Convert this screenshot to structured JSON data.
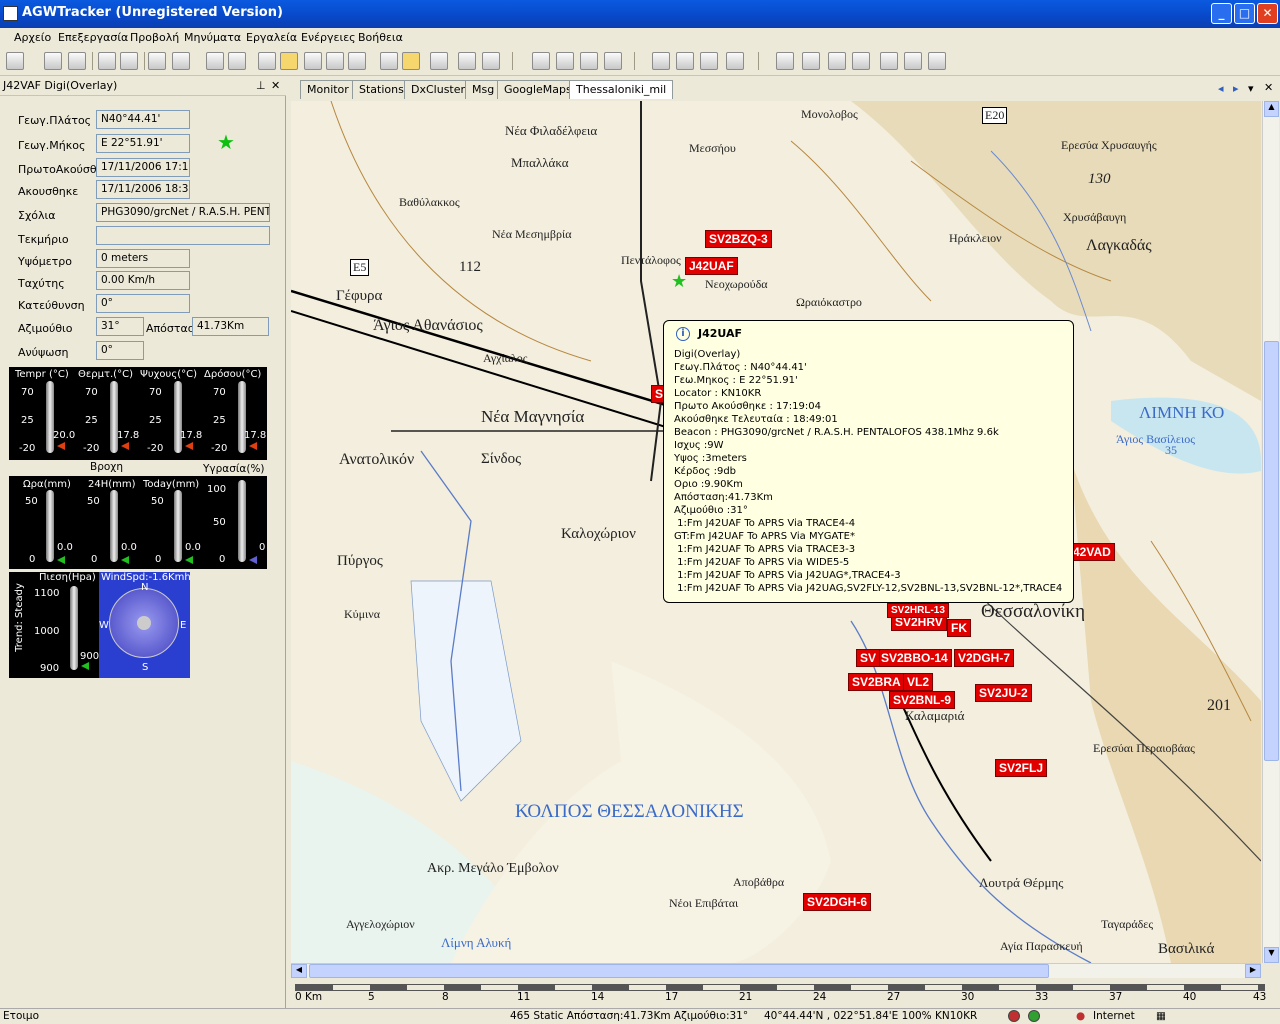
{
  "window": {
    "title": "AGWTracker (Unregistered Version)",
    "min": "_",
    "max": "□",
    "close": "✕"
  },
  "menu": [
    "Αρχείο",
    "Επεξεργασία",
    "Προβολή",
    "Μηνύματα",
    "Εργαλεία",
    "Ενέργειες",
    "Βοήθεια"
  ],
  "panel": {
    "title": "J42VAF Digi(Overlay)",
    "pin": "⊥",
    "close": "✕",
    "fields": [
      {
        "label": "Γεωγ.Πλάτος",
        "value": "N40°44.41'"
      },
      {
        "label": "Γεωγ.Μήκος",
        "value": "E 22°51.91'"
      },
      {
        "label": "ΠρωτοΑκούσθη",
        "value": "17/11/2006 17:1"
      },
      {
        "label": "Ακουσθηκε",
        "value": "17/11/2006 18:3"
      },
      {
        "label": "Σχόλια",
        "value": "PHG3090/grcNet / R.A.S.H. PENT."
      },
      {
        "label": "Τεκμήριο",
        "value": ""
      },
      {
        "label": "Υψόμετρο",
        "value": "0 meters"
      },
      {
        "label": "Ταχύτης",
        "value": "0.00 Km/h"
      },
      {
        "label": "Κατεύθυνση",
        "value": "0°"
      },
      {
        "label": "Αζιμούθιο",
        "value": "31°"
      },
      {
        "label": "Ανύψωση",
        "value": "0°"
      }
    ],
    "distance_label": "Απόστασ",
    "distance_value": "41.73Km"
  },
  "weather": {
    "temps": [
      {
        "label": "Tempr (°C)",
        "value": "20.0"
      },
      {
        "label": "Θερμτ.(°C)",
        "value": "17.8"
      },
      {
        "label": "Ψυχους(°C)",
        "value": "17.8"
      },
      {
        "label": "Δρόσου(°C)",
        "value": "17.8"
      }
    ],
    "temp_ticks": [
      "70",
      "25",
      "-20"
    ],
    "rain_title": "Βροχη",
    "humidity_label": "Υγρασία(%)",
    "rain": [
      {
        "label": "Ωρα(mm)",
        "value": "0.0"
      },
      {
        "label": "24H(mm)",
        "value": "0.0"
      },
      {
        "label": "Today(mm)",
        "value": "0.0"
      },
      {
        "label": "",
        "value": "0"
      }
    ],
    "rain_ticks": [
      "100",
      "50",
      "0"
    ],
    "pressure_label": "Πιεση(Hpa)",
    "pressure_ticks": [
      "1100",
      "1000",
      "900"
    ],
    "pressure_value": "900",
    "trend": "Trend: Steady",
    "wind": "WindSpd:-1.6Kmh",
    "compass": [
      "N",
      "S",
      "W",
      "E"
    ]
  },
  "tabs": [
    "Monitor",
    "Stations",
    "DxCluster",
    "Msg",
    "GoogleMaps",
    "Thessaloniki_mil"
  ],
  "popup": {
    "title": "J42UAF",
    "lines": [
      "Digi(Overlay)",
      "Γεωγ.Πλάτος  : N40°44.41'",
      "Γεω.Μηκος : E 22°51.91'",
      "Locator    : KN10KR",
      "Πρωτο Ακούσθηκε : 17:19:04",
      "Ακούσθηκε Τελευταία : 18:49:01",
      "Beacon : PHG3090/grcNet / R.A.S.H. PENTALOFOS 438.1Mhz 9.6k",
      "Ισχυς :9W",
      "Υψος :3meters",
      "Κέρδος :9db",
      "Οριο :9.90Km",
      "Απόσταση:41.73Km",
      "Αζιμούθιο :31°",
      " 1:Fm J42UAF To APRS Via TRACE4-4",
      "GT:Fm J42UAF To APRS Via MYGATE*",
      " 1:Fm J42UAF To APRS Via TRACE3-3",
      " 1:Fm J42UAF To APRS Via WIDE5-5",
      " 1:Fm J42UAF To APRS Via J42UAG*,TRACE4-3",
      " 1:Fm J42UAF To APRS Via J42UAG,SV2FLY-12,SV2BNL-13,SV2BNL-12*,TRACE4"
    ]
  },
  "callsigns": [
    "SV2BZQ-3",
    "J42UAF",
    "42VAD",
    "SV2HRV",
    "FK",
    "SV2BBO-14",
    "V2DGH-7",
    "SV2BRA",
    "VL2",
    "SV2BNL-9",
    "SV2JU-2",
    "SV2FLJ",
    "SV2DGH-6",
    "SV",
    "S",
    "SV2HRL-13"
  ],
  "map_labels": [
    "Μονολοβος",
    "Νέα Φιλαδέλφεια",
    "Μεσσήου",
    "Μπαλλάκα",
    "Βαθύλακκος",
    "Νέα Μεσημβρία",
    "Πεντάλοφος",
    "Νεοχωρούδα",
    "Ωραιόκαστρο",
    "Γέφυρα",
    "Άγιος Αθανάσιος",
    "Αγχίαλος",
    "Νέα Μαγνησία",
    "Ανατολικόν",
    "Σίνδος",
    "Καλοχώριον",
    "Πύργος",
    "Κύμινα",
    "Καλαμαριά",
    "ΚΟΛΠΟΣ ΘΕΣΣΑΛΟΝΙΚΗΣ",
    "Ακρ. Μεγάλο Έμβολον",
    "Αγγελοχώριον",
    "Νέοι Επιβάται",
    "Αποβάθρα",
    "Λίμνη Αλυκή",
    "Λαγκαδάς",
    "Ηράκλειον",
    "ΛΙΜΝΗ ΚΟ",
    "Άγιος Βασίλειος",
    "Ερεσύα Χρυσαυγής",
    "Χρυσάβαυγη",
    "Θεσσαλονίκη",
    "Λουτρά Θέρμης",
    "Αγία Παρασκευή",
    "Βασιλικά",
    "Ταγαράδες",
    "Ερεσύαι Περαιοβάας",
    "E20",
    "E5",
    "130",
    "35",
    "201",
    "112"
  ],
  "ruler": [
    "0 Km",
    "5",
    "8",
    "11",
    "14",
    "17",
    "21",
    "24",
    "27",
    "30",
    "33",
    "37",
    "40",
    "43"
  ],
  "status": {
    "left": "Ετοιμο",
    "center": "465 Static Απόσταση:41.73Km Αζιμούθιο:31°",
    "coords": "40°44.44'N , 022°51.84'E  100% KN10KR",
    "zone": "Internet"
  },
  "colors": {
    "callsign_bg": "#e00000",
    "title_bar": "#0848c8",
    "popup_bg": "#ffffe1"
  }
}
